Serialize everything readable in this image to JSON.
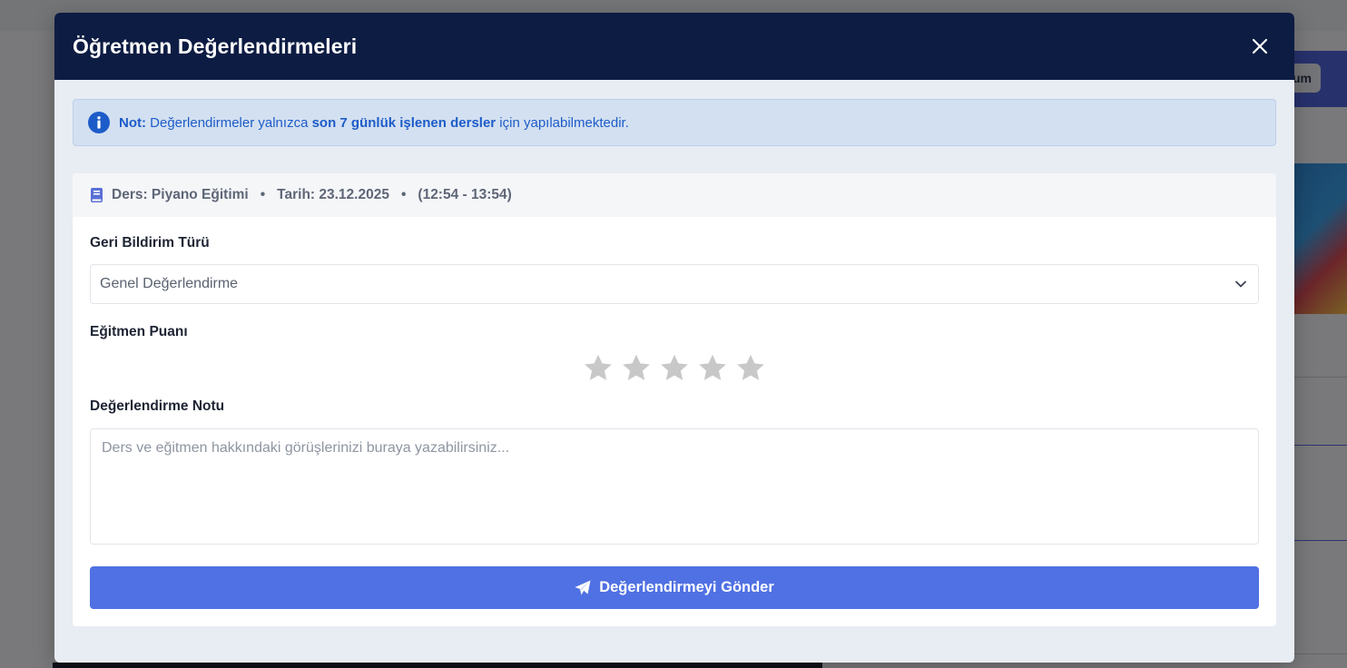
{
  "background": {
    "button_fragment": "um"
  },
  "modal": {
    "title": "Öğretmen Değerlendirmeleri",
    "close_icon": "close-icon"
  },
  "notice": {
    "icon": "info-icon",
    "lead": "Not:",
    "text_before": " Değerlendirmeler yalnızca ",
    "highlight": "son 7 günlük işlenen dersler",
    "text_after": " için yapılabilmektedir."
  },
  "lesson": {
    "icon": "book-icon",
    "course": "Ders: Piyano Eğitimi",
    "separator": "•",
    "date": "Tarih: 23.12.2025",
    "time": "(12:54 - 13:54)"
  },
  "form": {
    "feedback_type_label": "Geri Bildirim Türü",
    "feedback_type_value": "Genel Değerlendirme",
    "rating_label": "Eğitmen Puanı",
    "rating_value": 0,
    "rating_max": 5,
    "note_label": "Değerlendirme Notu",
    "note_placeholder": "Ders ve eğitmen hakkındaki görüşlerinizi buraya yazabilirsiniz...",
    "note_value": "",
    "submit_label": "Değerlendirmeyi Gönder",
    "submit_icon": "paper-plane-icon"
  },
  "colors": {
    "header_bg": "#0d1c43",
    "notice_bg": "#d3e0f1",
    "notice_text": "#1d5cc8",
    "submit_bg": "#5071e3",
    "star_empty": "#c8c8c8"
  }
}
